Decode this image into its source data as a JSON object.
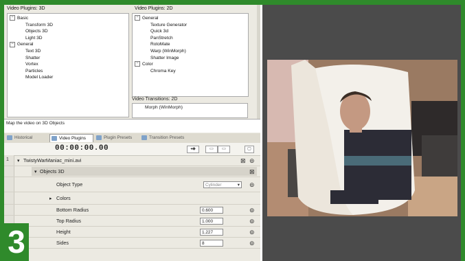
{
  "panel_3d": {
    "title": "Video Plugins: 3D",
    "items": [
      {
        "label": "Basic",
        "toggle": "−"
      },
      {
        "label": "Transform 3D"
      },
      {
        "label": "Objects 3D"
      },
      {
        "label": "Light 3D"
      },
      {
        "label": "General",
        "toggle": "−"
      },
      {
        "label": "Text 3D"
      },
      {
        "label": "Shatter"
      },
      {
        "label": "Vortex"
      },
      {
        "label": "Particles"
      },
      {
        "label": "Model Loader"
      }
    ]
  },
  "panel_2d": {
    "title": "Video Plugins: 2D",
    "items": [
      {
        "label": "General",
        "toggle": "−"
      },
      {
        "label": "Texture Generator"
      },
      {
        "label": "Quick 3d"
      },
      {
        "label": "PanStretch"
      },
      {
        "label": "RotoMate"
      },
      {
        "label": "Warp (WinMorph)"
      },
      {
        "label": "Shatter Image"
      },
      {
        "label": "Color",
        "toggle": "−"
      },
      {
        "label": "Chroma Key"
      }
    ]
  },
  "transitions": {
    "title": "Video Transitions: 2D",
    "item": "Morph (WinMorph)"
  },
  "description": "Map the video on 3D Objects",
  "tabs": [
    "Historical",
    "Video Plugins",
    "Plugin Presets",
    "Transition Presets"
  ],
  "timecode": "00:00:00.00",
  "track": {
    "row_number": "1",
    "name": "TwistyWarManiac_mini.avi"
  },
  "plugin_header": "Objects 3D",
  "properties": {
    "object_type_label": "Object Type",
    "object_type_value": "Cylinder",
    "colors_label": "Colors",
    "bottom_radius_label": "Bottom Radius",
    "bottom_radius_value": "0.600",
    "top_radius_label": "Top Radius",
    "top_radius_value": "1.000",
    "height_label": "Height",
    "height_value": "1.227",
    "sides_label": "Sides",
    "sides_value": "8"
  },
  "step_badge": "3",
  "colors": {
    "page_border": "#2f8a2b",
    "viewer_background": "#4b4b4b",
    "panel_background": "#eceae2"
  }
}
